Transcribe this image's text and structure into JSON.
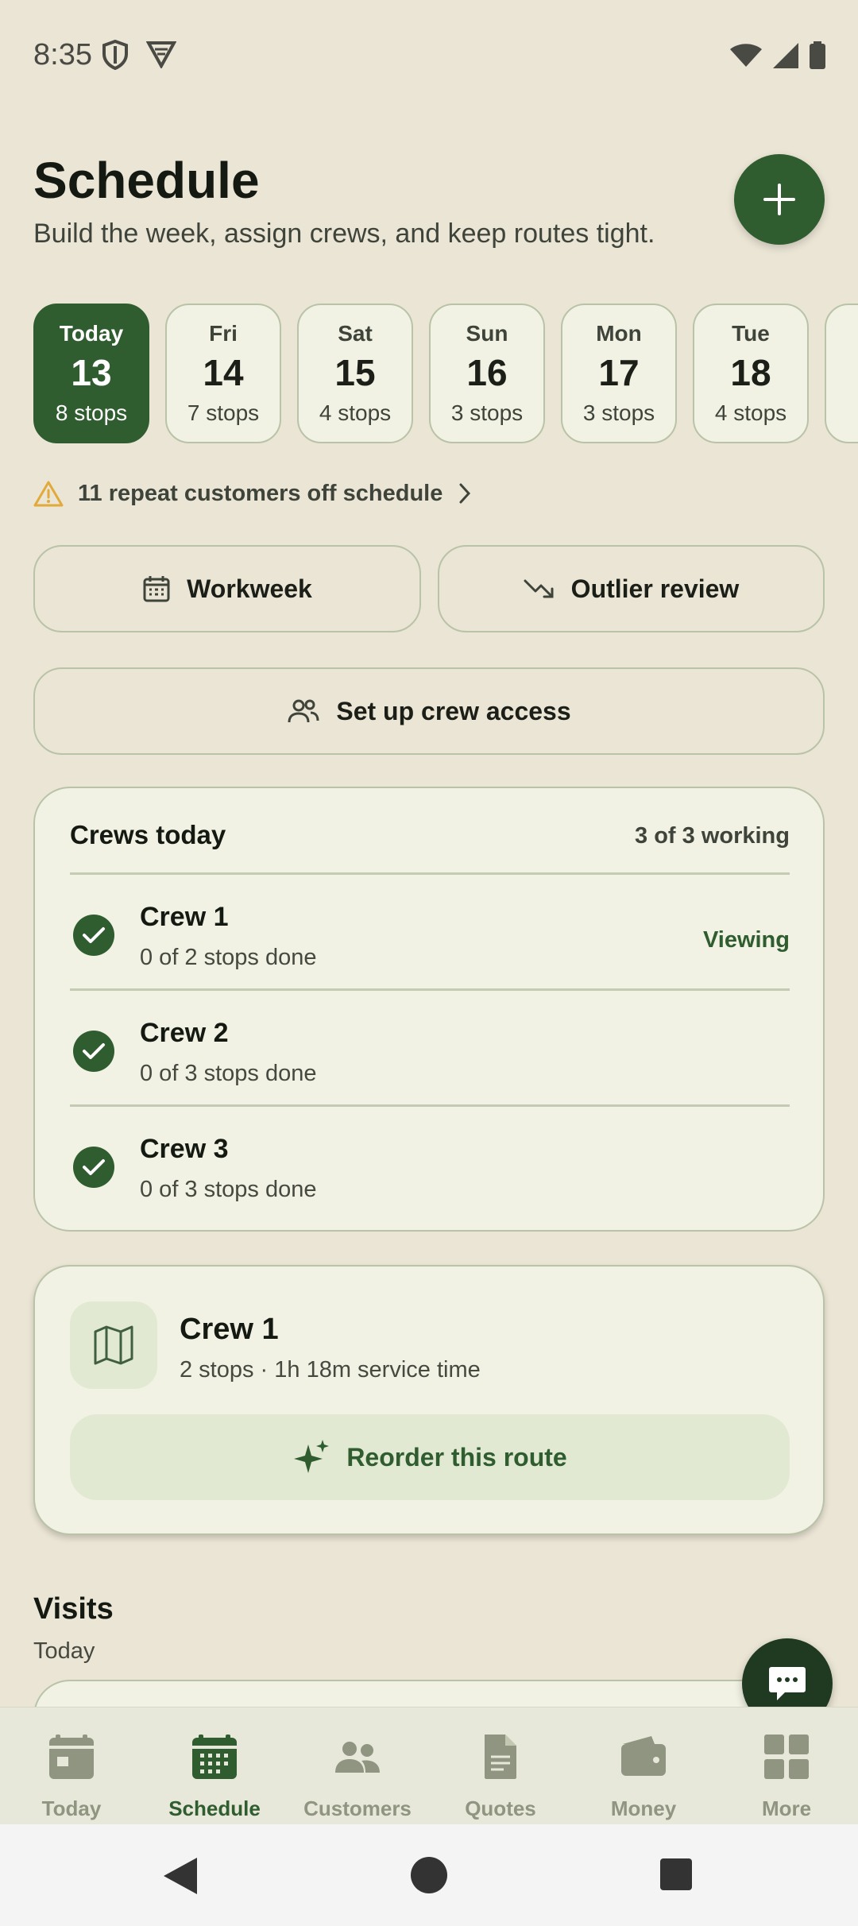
{
  "status": {
    "time": "8:35"
  },
  "header": {
    "title": "Schedule",
    "subtitle": "Build the week, assign crews, and keep routes tight."
  },
  "days": [
    {
      "name": "Today",
      "num": "13",
      "stops": "8 stops",
      "selected": true
    },
    {
      "name": "Fri",
      "num": "14",
      "stops": "7 stops"
    },
    {
      "name": "Sat",
      "num": "15",
      "stops": "4 stops"
    },
    {
      "name": "Sun",
      "num": "16",
      "stops": "3 stops"
    },
    {
      "name": "Mon",
      "num": "17",
      "stops": "3 stops"
    },
    {
      "name": "Tue",
      "num": "18",
      "stops": "4 stops"
    }
  ],
  "alert": {
    "text": "11 repeat customers off schedule"
  },
  "actions": {
    "workweek": "Workweek",
    "outlier": "Outlier review",
    "crew_access": "Set up crew access"
  },
  "crews": {
    "title": "Crews today",
    "count": "3 of 3 working",
    "items": [
      {
        "name": "Crew 1",
        "sub": "0 of 2 stops done",
        "tag": "Viewing"
      },
      {
        "name": "Crew 2",
        "sub": "0 of 3 stops done"
      },
      {
        "name": "Crew 3",
        "sub": "0 of 3 stops done"
      }
    ]
  },
  "route": {
    "title": "Crew 1",
    "sub": "2 stops · 1h 18m service time",
    "reorder": "Reorder this route"
  },
  "visits": {
    "title": "Visits",
    "sub": "Today"
  },
  "nav": [
    {
      "label": "Today",
      "icon": "calendar-day-icon"
    },
    {
      "label": "Schedule",
      "icon": "calendar-grid-icon",
      "active": true
    },
    {
      "label": "Customers",
      "icon": "people-icon"
    },
    {
      "label": "Quotes",
      "icon": "document-icon"
    },
    {
      "label": "Money",
      "icon": "wallet-icon"
    },
    {
      "label": "More",
      "icon": "grid-icon"
    }
  ],
  "colors": {
    "accent": "#2f5d2f",
    "background": "#ebe5d5",
    "card": "#f1f2e4",
    "warning": "#e2a93b"
  }
}
